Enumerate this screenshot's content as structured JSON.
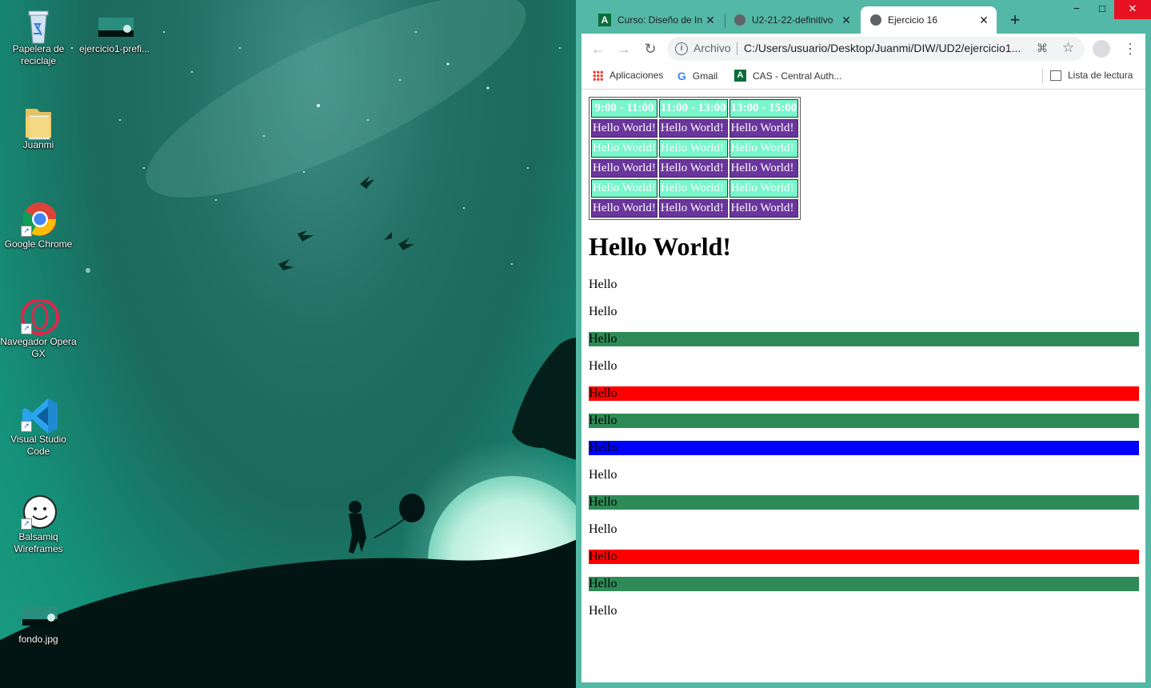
{
  "desktop": {
    "icons": [
      {
        "label": "Papelera de reciclaje",
        "icon": "recycle-bin-icon"
      },
      {
        "label": "ejercicio1-prefi...",
        "icon": "image-file-icon"
      },
      {
        "label": "Juanmi",
        "icon": "folder-icon"
      },
      {
        "label": "Google Chrome",
        "icon": "chrome-icon"
      },
      {
        "label": "Navegador Opera GX",
        "icon": "opera-gx-icon"
      },
      {
        "label": "Visual Studio Code",
        "icon": "vscode-icon"
      },
      {
        "label": "Balsamiq Wireframes",
        "icon": "balsamiq-icon"
      },
      {
        "label": "fondo.jpg",
        "icon": "image-file-icon"
      }
    ]
  },
  "browser": {
    "tabs": [
      {
        "title": "Curso: Diseño de In",
        "icon": "moodle-icon"
      },
      {
        "title": "U2-21-22-definitivo",
        "icon": "globe-icon"
      },
      {
        "title": "Ejercicio 16",
        "icon": "globe-icon",
        "active": true
      }
    ],
    "new_tab_symbol": "+",
    "window_controls": {
      "minimize": "−",
      "maximize": "□",
      "close": "✕"
    },
    "omnibox": {
      "scheme_label": "Archivo",
      "url": "C:/Users/usuario/Desktop/Juanmi/DIW/UD2/ejercicio1..."
    },
    "bookmarks": [
      {
        "label": "Aplicaciones",
        "icon": "apps-grid-icon"
      },
      {
        "label": "Gmail",
        "icon": "google-icon"
      },
      {
        "label": "CAS - Central Auth...",
        "icon": "moodle-icon"
      }
    ],
    "reading_list": "Lista de lectura"
  },
  "page": {
    "table": {
      "headers": [
        "9:00 - 11:00",
        "11:00 - 13:00",
        "13:00 - 15:00"
      ],
      "rows": [
        [
          "Hello World!",
          "Hello World!",
          "Hello World!"
        ],
        [
          "Hello World!",
          "Hello World!",
          "Hello World!"
        ],
        [
          "Hello World!",
          "Hello World!",
          "Hello World!"
        ],
        [
          "Hello World!",
          "Hello World!",
          "Hello World!"
        ],
        [
          "Hello World!",
          "Hello World!",
          "Hello World!"
        ]
      ]
    },
    "heading": "Hello World!",
    "paragraphs": [
      {
        "text": "Hello",
        "bg": ""
      },
      {
        "text": "Hello",
        "bg": ""
      },
      {
        "text": "Hello",
        "bg": "#2e8b57"
      },
      {
        "text": "Hello",
        "bg": ""
      },
      {
        "text": "Hello",
        "bg": "#ff0000"
      },
      {
        "text": "Hello",
        "bg": "#2e8b57"
      },
      {
        "text": "Hello",
        "bg": "#0000ff"
      },
      {
        "text": "Hello",
        "bg": ""
      },
      {
        "text": "Hello",
        "bg": "#2e8b57"
      },
      {
        "text": "Hello",
        "bg": ""
      },
      {
        "text": "Hello",
        "bg": "#ff0000"
      },
      {
        "text": "Hello",
        "bg": "#2e8b57"
      },
      {
        "text": "Hello",
        "bg": ""
      }
    ],
    "colors": {
      "purple_row": "#6a359c",
      "mint_row": "#79f7cc"
    }
  }
}
